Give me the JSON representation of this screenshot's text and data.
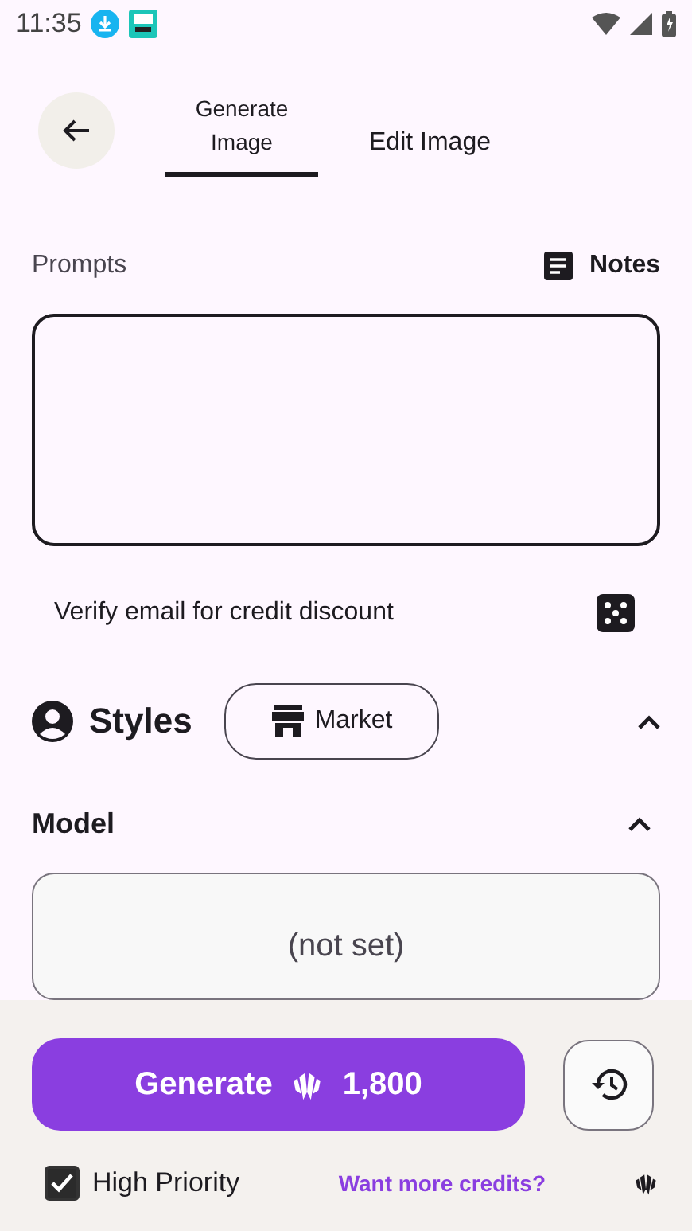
{
  "status_bar": {
    "time": "11:35"
  },
  "tabs": [
    {
      "label": "Generate Image",
      "selected": true
    },
    {
      "label": "Edit Image",
      "selected": false
    }
  ],
  "prompts": {
    "label": "Prompts",
    "notes_button": "Notes"
  },
  "verify_notice": "Verify email for credit discount",
  "styles": {
    "label": "Styles",
    "market_button": "Market",
    "expanded": true
  },
  "model": {
    "label": "Model",
    "expanded": true,
    "value": "(not set)"
  },
  "generate_button": {
    "label": "Generate",
    "cost": "1,800"
  },
  "high_priority": {
    "label": "High Priority",
    "checked": true
  },
  "credits_link": "Want more credits?"
}
